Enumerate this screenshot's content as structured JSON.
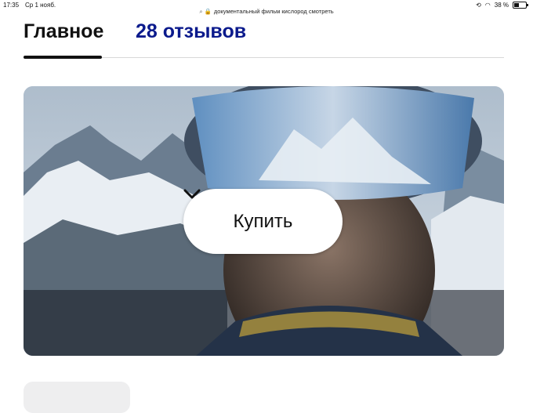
{
  "status_bar": {
    "time": "17:35",
    "date": "Ср 1 нояб.",
    "url": "документальный фильм кислород смотреть",
    "battery": "38 %",
    "battery_level": 0.38
  },
  "tabs": [
    {
      "label": "Главное",
      "active": true
    },
    {
      "label": "28 отзывов",
      "active": false
    }
  ],
  "hero": {
    "buy_label": "Купить"
  },
  "colors": {
    "reviews_tab": "#0b1a8c",
    "active_underline": "#111111",
    "button_bg": "#ffffff"
  }
}
